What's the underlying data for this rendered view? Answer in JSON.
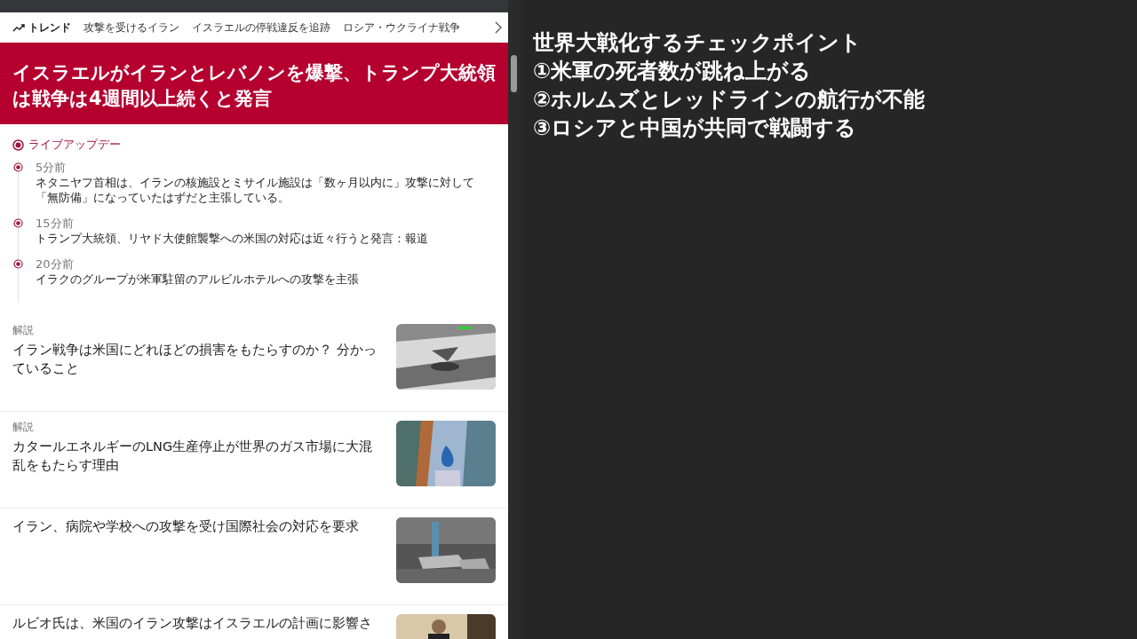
{
  "trend_bar": {
    "label": "トレンド",
    "topics": [
      "攻撃を受けるイラン",
      "イスラエルの停戦違反を追跡",
      "ロシア・ウクライナ戦争"
    ]
  },
  "headline": {
    "title": "イスラエルがイランとレバノンを爆撃、トランプ大統領は戦争は4週間以上続くと発言"
  },
  "live": {
    "label": "ライブアップデー",
    "updates": [
      {
        "time": "5分前",
        "text": "ネタニヤフ首相は、イランの核施設とミサイル施設は「数ヶ月以内に」攻撃に対して「無防備」になっていたはずだと主張している。"
      },
      {
        "time": "15分前",
        "text": "トランプ大統領、リヤド大使館襲撃への米国の対応は近々行うと発言：報道"
      },
      {
        "time": "20分前",
        "text": "イラクのグループが米軍駐留のアルビルホテルへの攻撃を主張"
      }
    ]
  },
  "articles": [
    {
      "tag": "解説",
      "title": "イラン戦争は米国にどれほどの損害をもたらすのか？ 分かっていること"
    },
    {
      "tag": "解説",
      "title": "カタールエネルギーのLNG生産停止が世界のガス市場に大混乱をもたらす理由"
    },
    {
      "title": "イラン、病院や学校への攻撃を受け国際社会の対応を要求"
    },
    {
      "title": "ルビオ氏は、米国のイラン攻撃はイスラエルの計画に影響さ"
    }
  ],
  "overlay": {
    "heading": "世界大戦化するチェックポイント",
    "points": [
      "①米軍の死者数が跳ね上がる",
      "②ホルムズとレッドラインの航行が不能",
      "③ロシアと中国が共同で戦闘する"
    ]
  }
}
